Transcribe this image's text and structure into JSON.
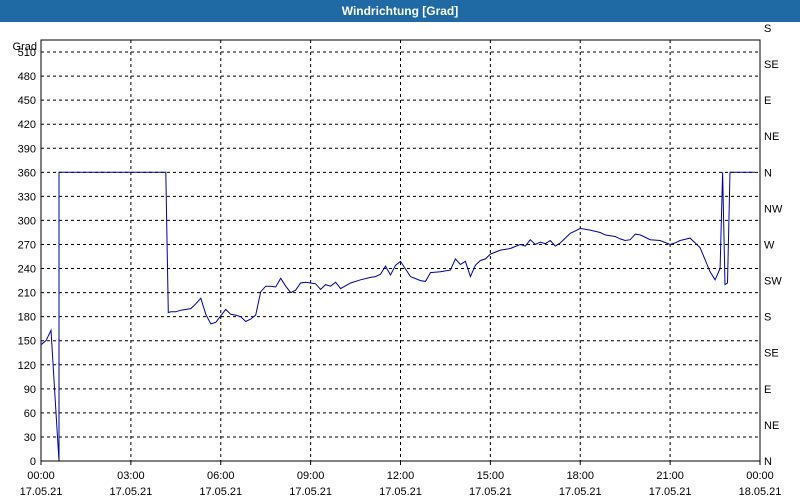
{
  "window": {
    "title": "Windrichtung [Grad]"
  },
  "chart_data": {
    "type": "line",
    "title": "Windrichtung [Grad]",
    "ylabel": "Grad",
    "ylim": [
      0,
      525
    ],
    "xlim": [
      "17.05.21 00:00",
      "18.05.21 00:00"
    ],
    "y_ticks": [
      0,
      30,
      60,
      90,
      120,
      150,
      180,
      210,
      240,
      270,
      300,
      330,
      360,
      390,
      420,
      450,
      480,
      510
    ],
    "right_axis_labels": [
      "N",
      "NE",
      "E",
      "SE",
      "S",
      "SW",
      "W",
      "NW",
      "N",
      "NE",
      "E",
      "SE",
      "S"
    ],
    "x_ticks": [
      {
        "time": "00:00",
        "date": "17.05.21"
      },
      {
        "time": "03:00",
        "date": "17.05.21"
      },
      {
        "time": "06:00",
        "date": "17.05.21"
      },
      {
        "time": "09:00",
        "date": "17.05.21"
      },
      {
        "time": "12:00",
        "date": "17.05.21"
      },
      {
        "time": "15:00",
        "date": "17.05.21"
      },
      {
        "time": "18:00",
        "date": "17.05.21"
      },
      {
        "time": "21:00",
        "date": "17.05.21"
      },
      {
        "time": "00:00",
        "date": "18.05.21"
      }
    ],
    "grid": true,
    "line_color": "#0000a0",
    "series": [
      {
        "x": [
          "00:00",
          "00:10",
          "00:20",
          "00:30",
          "00:36",
          "00:36",
          "04:00",
          "04:10",
          "04:15",
          "04:20",
          "04:30",
          "04:40",
          "05:00",
          "05:10",
          "05:20",
          "05:30",
          "05:40",
          "05:50",
          "06:10",
          "06:20",
          "06:30",
          "06:40",
          "06:50",
          "07:00",
          "07:10",
          "07:20",
          "07:30",
          "07:40",
          "07:50",
          "08:00",
          "08:10",
          "08:20",
          "08:30",
          "08:40",
          "08:50",
          "09:00",
          "09:10",
          "09:20",
          "09:30",
          "09:40",
          "09:50",
          "10:00",
          "10:20",
          "10:40",
          "11:00",
          "11:10",
          "11:20",
          "11:30",
          "11:40",
          "11:50",
          "12:00",
          "12:20",
          "12:40",
          "12:50",
          "13:00",
          "13:20",
          "13:30",
          "13:40",
          "13:50",
          "14:00",
          "14:10",
          "14:20",
          "14:30",
          "14:40",
          "14:50",
          "15:00",
          "15:20",
          "15:40",
          "16:00",
          "16:10",
          "16:20",
          "16:30",
          "16:40",
          "16:50",
          "17:00",
          "17:10",
          "17:20",
          "17:30",
          "17:40",
          "17:50",
          "18:00",
          "18:20",
          "18:40",
          "18:50",
          "19:00",
          "19:10",
          "19:20",
          "19:30",
          "19:40",
          "19:50",
          "20:00",
          "20:20",
          "20:40",
          "21:00",
          "21:10",
          "21:20",
          "21:40",
          "22:00",
          "22:20",
          "22:30",
          "22:40",
          "22:45",
          "22:50",
          "22:55",
          "23:00",
          "23:10",
          "23:20",
          "23:30",
          "23:40",
          "23:50"
        ],
        "values": [
          145,
          150,
          163,
          60,
          0,
          360,
          360,
          360,
          185,
          186,
          186,
          188,
          190,
          196,
          203,
          183,
          171,
          173,
          189,
          183,
          182,
          180,
          174,
          177,
          182,
          211,
          218,
          218,
          217,
          228,
          218,
          210,
          213,
          222,
          223,
          222,
          221,
          214,
          220,
          218,
          223,
          215,
          222,
          226,
          229,
          230,
          233,
          243,
          232,
          244,
          249,
          230,
          225,
          224,
          235,
          236,
          237,
          238,
          252,
          245,
          249,
          230,
          244,
          250,
          252,
          258,
          263,
          265,
          270,
          268,
          276,
          270,
          273,
          271,
          275,
          268,
          272,
          278,
          284,
          287,
          290,
          288,
          285,
          282,
          281,
          280,
          277,
          275,
          276,
          283,
          282,
          276,
          275,
          270,
          272,
          275,
          278,
          266,
          236,
          226,
          240,
          360,
          220,
          222,
          360,
          360,
          360,
          360,
          360,
          360
        ]
      }
    ]
  }
}
